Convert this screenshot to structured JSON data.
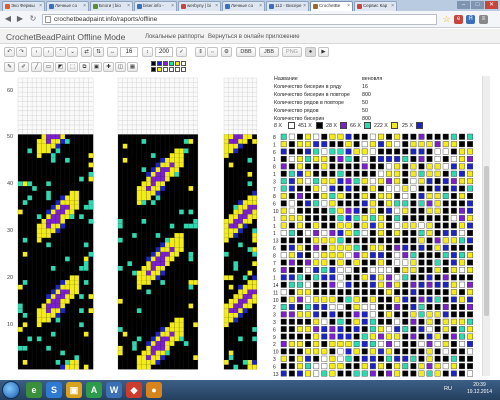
{
  "browser": {
    "tabs": [
      {
        "label": "Эко Фермы",
        "color": "#e05a2a"
      },
      {
        "label": "Личные со",
        "color": "#3b6fb6"
      },
      {
        "label": "Блоги | bio",
        "color": "#5a8f3a"
      },
      {
        "label": "biser.info -",
        "color": "#3b6fb6"
      },
      {
        "label": "werbyny | bi",
        "color": "#c8453c"
      },
      {
        "label": "Личные со",
        "color": "#3b6fb6"
      },
      {
        "label": "112 - Bисере",
        "color": "#3b6fb6"
      },
      {
        "label": "CrochetBe",
        "color": "#9b6b2a",
        "active": true
      },
      {
        "label": "Сервис Кар",
        "color": "#c8453c"
      }
    ],
    "url": "crochetbeadpaint.info/raports/offline",
    "window_buttons": [
      "–",
      "□",
      "✕"
    ]
  },
  "app": {
    "title": "CrochetBeadPaint Offline Mode",
    "links": [
      "Локальные раппорты",
      "Вернуться в онлайн приложение"
    ]
  },
  "toolbar": {
    "width_value": "16",
    "height_value": "200",
    "dbb_label": "DBB",
    "jbb_label": "JBB",
    "png_label": "PNG"
  },
  "row_numbers": [
    "60",
    "50",
    "40",
    "30",
    "20",
    "10"
  ],
  "colors": {
    "black": "#000000",
    "yellow": "#f4ec1a",
    "blue": "#1c23c8",
    "purple": "#7c1fd0",
    "teal": "#2fd9b0",
    "white": "#ffffff",
    "grid": "#c8c8c8"
  },
  "info": {
    "rows": [
      {
        "label": "Название",
        "value": "веновля"
      },
      {
        "label": "Количество бисерин в ряду",
        "value": "16"
      },
      {
        "label": "Количество бисерин в повторе",
        "value": "800"
      },
      {
        "label": "Количество рядов в повторе",
        "value": "50"
      },
      {
        "label": "Количество рядов",
        "value": "50"
      },
      {
        "label": "Количество бисерин",
        "value": "800"
      }
    ]
  },
  "counts": [
    {
      "label": "8 X",
      "color": "#ffffff"
    },
    {
      "label": "451 X",
      "color": "#000000"
    },
    {
      "label": "28 X",
      "color": "#7c1fd0"
    },
    {
      "label": "66 X",
      "color": "#2fd9b0"
    },
    {
      "label": "222 X",
      "color": "#f4ec1a"
    },
    {
      "label": "25 X",
      "color": "#1c23c8"
    }
  ],
  "bead_list_numbers": [
    "8",
    "1",
    "6",
    "1",
    "8",
    "1",
    "3",
    "7",
    "8",
    "6",
    "10",
    "1",
    "1",
    "1",
    "13",
    "6",
    "8",
    "7",
    "6",
    "1",
    "14",
    "11",
    "10",
    "2",
    "3",
    "3",
    "6",
    "9",
    "2",
    "10",
    "3",
    "6",
    "13",
    "3",
    "1",
    "14",
    "10",
    "13",
    "3",
    "1",
    "6",
    "10"
  ],
  "taskbar": {
    "lang": "RU",
    "time": "20:39",
    "date": "19.12.2014"
  }
}
